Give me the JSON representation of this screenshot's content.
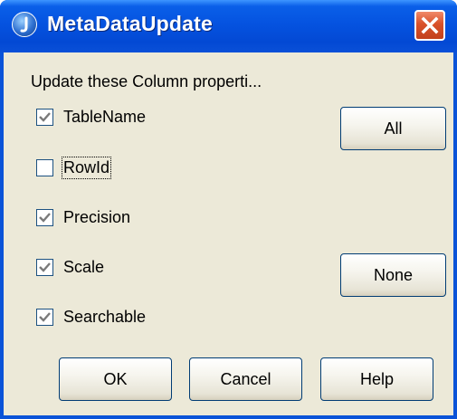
{
  "window": {
    "title": "MetaDataUpdate",
    "app_icon": "java-icon",
    "close_icon": "close-icon"
  },
  "dialog": {
    "instruction": "Update these Column properti...",
    "checkboxes": [
      {
        "label": "TableName",
        "checked": true
      },
      {
        "label": "RowId",
        "checked": false,
        "focused": true
      },
      {
        "label": "Precision",
        "checked": true
      },
      {
        "label": "Scale",
        "checked": true
      },
      {
        "label": "Searchable",
        "checked": true
      }
    ],
    "buttons": {
      "all": "All",
      "none": "None",
      "ok": "OK",
      "cancel": "Cancel",
      "help": "Help"
    }
  },
  "colors": {
    "titlebar": "#0553E0",
    "client_background": "#ECE9D8",
    "close_button": "#D9512A",
    "checkbox_border": "#1C5180",
    "checkmark_checked": "#7A7A7A"
  }
}
